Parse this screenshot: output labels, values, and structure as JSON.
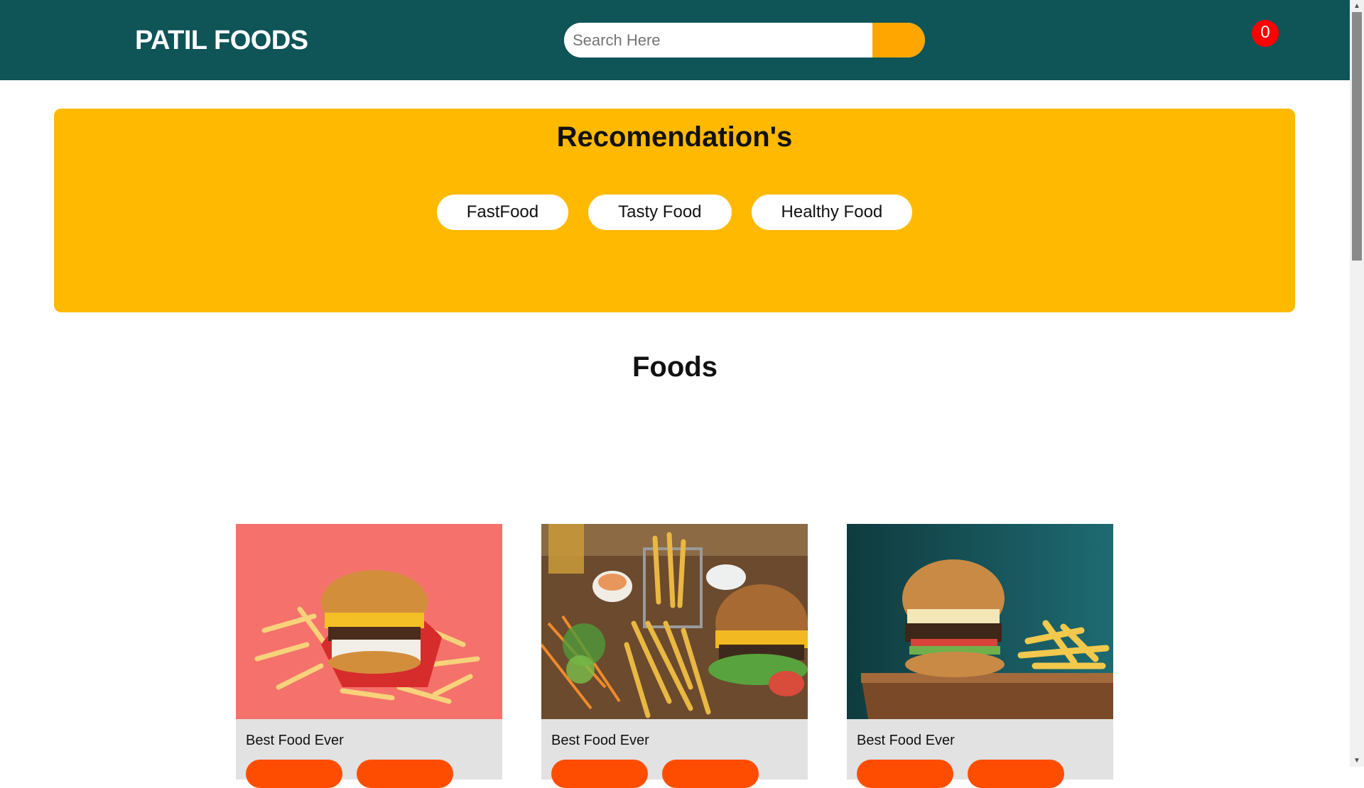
{
  "header": {
    "brand": "PATIL FOODS",
    "search_placeholder": "Search Here",
    "cart_count": "0"
  },
  "recommendations": {
    "title": "Recomendation's",
    "buttons": [
      "FastFood",
      "Tasty Food",
      "Healthy Food"
    ]
  },
  "foods": {
    "title": "Foods",
    "cards": [
      {
        "title": "Best Food Ever",
        "image": "burger-and-fries-on-pink"
      },
      {
        "title": "Best Food Ever",
        "image": "burger-fries-salad-on-wood"
      },
      {
        "title": "Best Food Ever",
        "image": "burger-and-fries-on-board-teal"
      }
    ]
  },
  "colors": {
    "header_bg": "#0f5457",
    "search_button": "#ffa600",
    "cart_badge": "#ff0000",
    "recommend_panel": "#ffb900",
    "card_bg": "#e2e2e2",
    "card_button": "#ff4d00"
  }
}
